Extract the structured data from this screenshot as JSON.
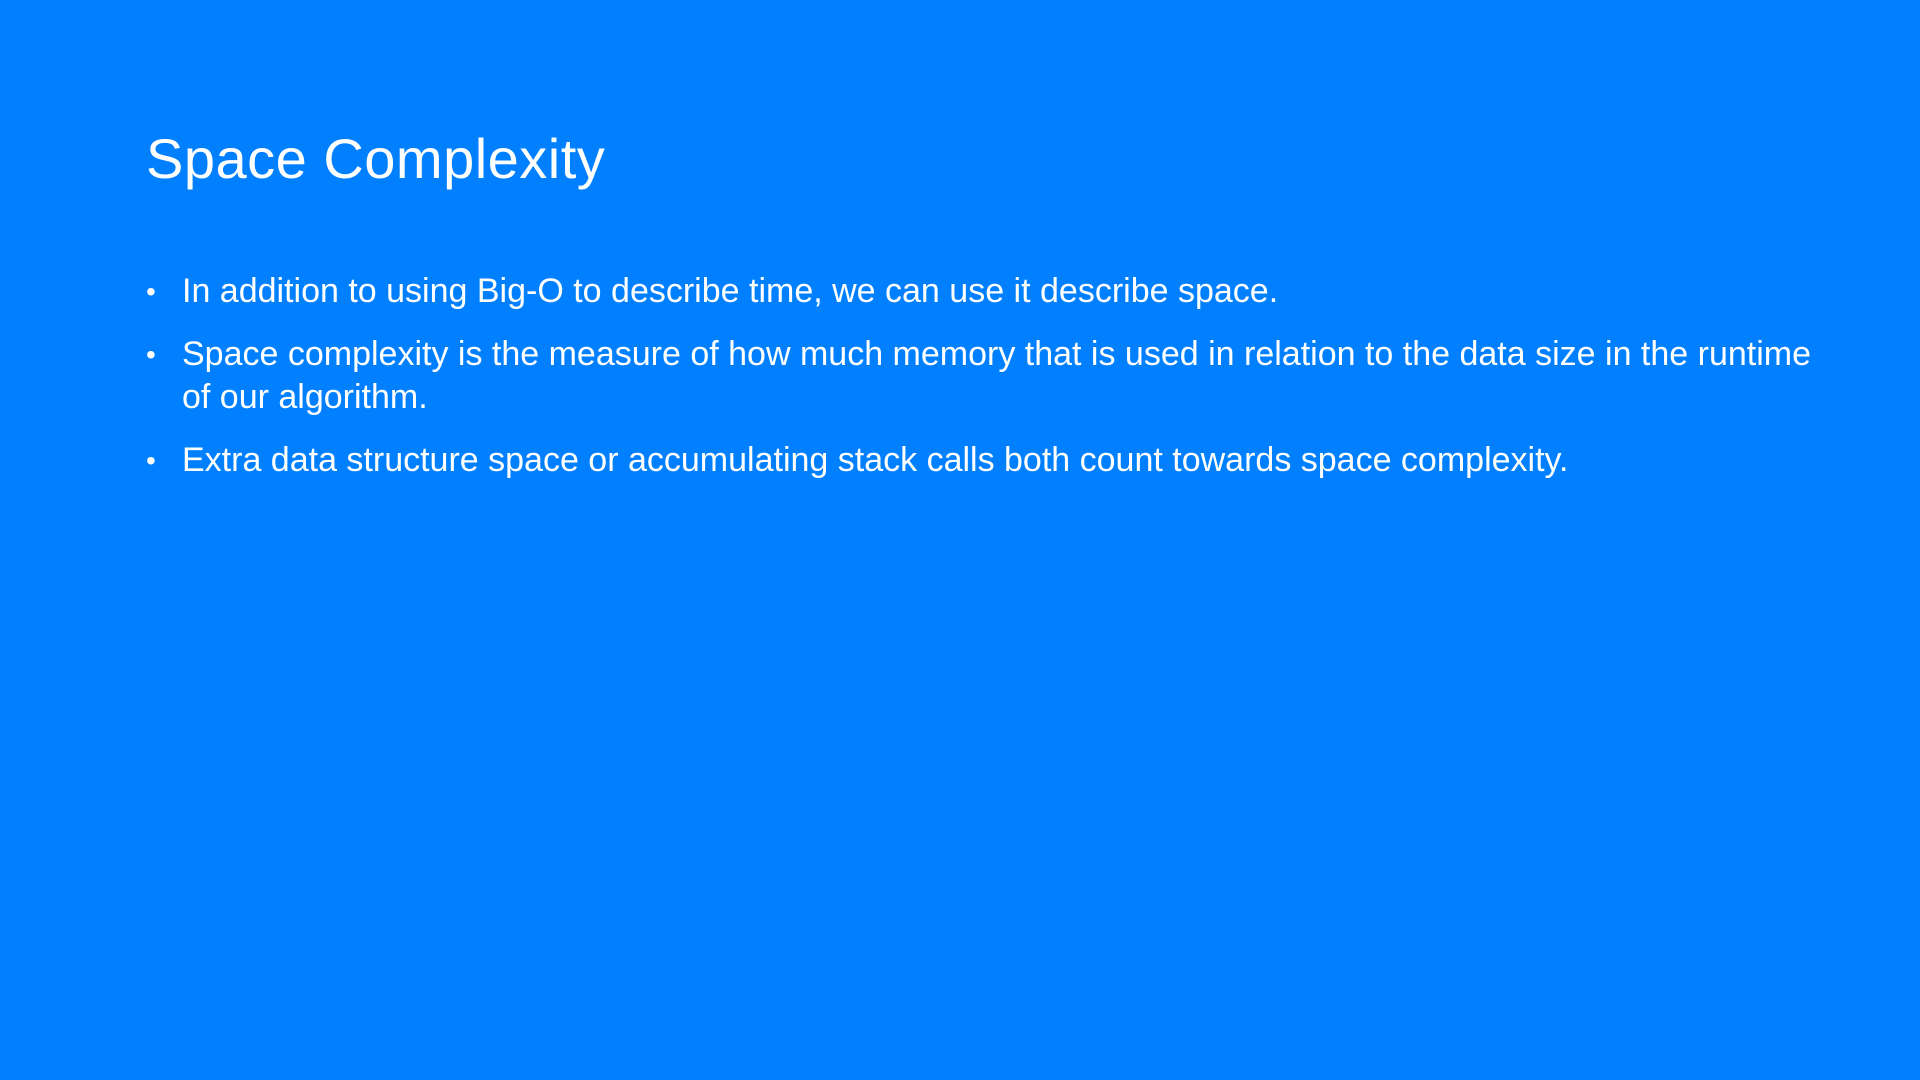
{
  "slide": {
    "background_color": "#0080ff",
    "text_color": "#ffffff",
    "title": "Space Complexity",
    "bullet_symbol": "•",
    "bullets": [
      "In addition to using Big-O to describe time, we can use it describe space.",
      "Space complexity is the measure of how much memory that is used in relation to the data size in the runtime of our algorithm.",
      "Extra data structure space or accumulating stack calls both count towards space complexity."
    ]
  }
}
